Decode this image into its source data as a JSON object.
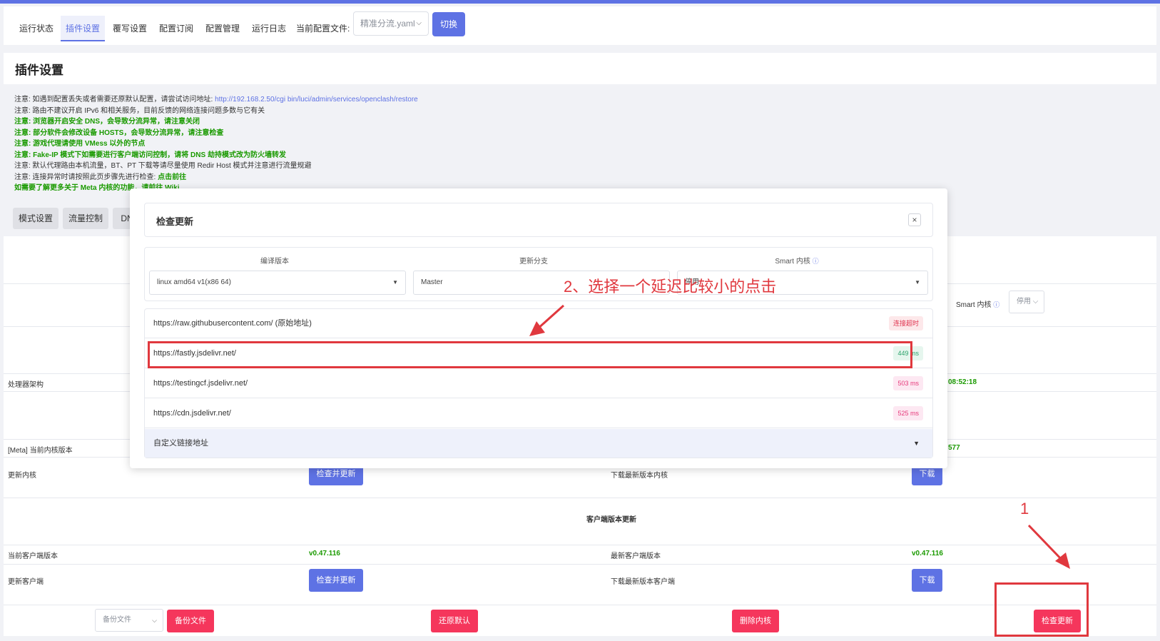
{
  "nav": {
    "tabs": [
      "运行状态",
      "插件设置",
      "覆写设置",
      "配置订阅",
      "配置管理",
      "运行日志"
    ],
    "config_label": "当前配置文件:",
    "config_value": "精准分流.yaml",
    "switch_label": "切换"
  },
  "page": {
    "title": "插件设置"
  },
  "notes": {
    "n1_text": "注意: 如遇到配置丢失或者需要还原默认配置，请尝试访问地址: ",
    "n1_link": "http://192.168.2.50/cgi bin/luci/admin/services/openclash/restore",
    "n2": "注意: 路由不建议开启 IPv6 和相关服务，目前反馈的网络连接问题多数与它有关",
    "n3": "注意: 浏览器开启安全 DNS，会导致分流异常，请注意关闭",
    "n4": "注意: 部分软件会修改设备 HOSTS，会导致分流异常，请注意检查",
    "n5": "注意: 游戏代理请使用 VMess 以外的节点",
    "n6": "注意: Fake-IP 模式下如需要进行客户端访问控制，请将 DNS 劫持模式改为防火墙转发",
    "n7": "注意: 默认代理路由本机流量，BT、PT 下载等请尽量使用 Redir Host 模式并注意进行流量规避",
    "n8_text": "注意: 连接异常时请按照此页步骤先进行检查: ",
    "n8_link": "点击前往",
    "n9": "如需要了解更多关于 Meta 内核的功能，请前往 Wiki"
  },
  "subtabs": [
    "模式设置",
    "流量控制",
    "DN"
  ],
  "table": {
    "arch_label": "处理器架构",
    "arch_right_value": "08:52:18",
    "meta_version_label": "[Meta] 当前内核版本",
    "meta_version_right_value": "577",
    "update_core_label": "更新内核",
    "check_update_btn": "检查并更新",
    "download_latest_core_label": "下载最新版本内核",
    "download_btn": "下载",
    "client_section_title": "客户端版本更新",
    "current_client_label": "当前客户端版本",
    "current_client_value": "v0.47.116",
    "latest_client_label": "最新客户端版本",
    "latest_client_value": "v0.47.116",
    "update_client_label": "更新客户端",
    "download_latest_client_label": "下载最新版本客户端",
    "smart_core_label": "Smart 内核",
    "use_value": "停用"
  },
  "bottom": {
    "backup_select": "备份文件",
    "backup_btn": "备份文件",
    "restore_btn": "还原默认",
    "delete_core_btn": "删除内核",
    "check_update_btn": "检查更新"
  },
  "modal": {
    "title": "检查更新",
    "close_icon": "×",
    "build_label": "编译版本",
    "build_value": "linux amd64 v1(x86 64)",
    "branch_label": "更新分支",
    "branch_value": "Master",
    "smart_label": "Smart 内核",
    "smart_value": "停用",
    "mirrors": [
      {
        "url": "https://raw.githubusercontent.com/ (原始地址)",
        "status": "连接超时"
      },
      {
        "url": "https://fastly.jsdelivr.net/",
        "status": "449 ms"
      },
      {
        "url": "https://testingcf.jsdelivr.net/",
        "status": "503 ms"
      },
      {
        "url": "https://cdn.jsdelivr.net/",
        "status": "525 ms"
      }
    ],
    "custom_link_label": "自定义链接地址"
  },
  "annotations": {
    "step1": "1",
    "step2": "2、选择一个延迟比较小的点击",
    "color": "#e0383e"
  },
  "colors": {
    "accent": "#5e72e4",
    "danger": "#f5365c",
    "success": "#1a9a00"
  }
}
